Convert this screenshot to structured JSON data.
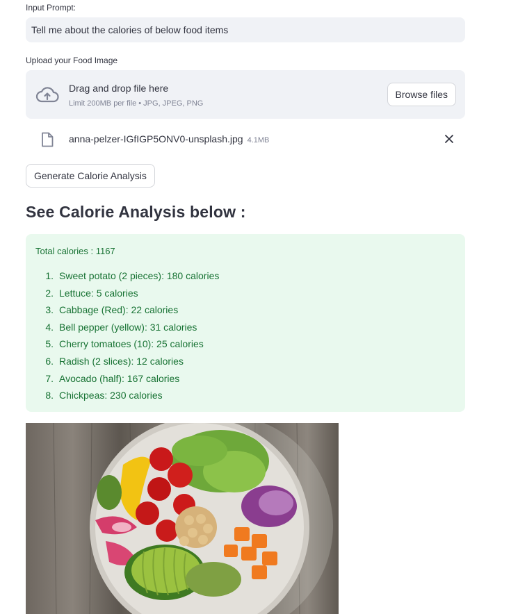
{
  "prompt": {
    "label": "Input Prompt:",
    "value": "Tell me about the calories of below food items"
  },
  "upload": {
    "label": "Upload your Food Image",
    "drag_title": "Drag and drop file here",
    "drag_sub": "Limit 200MB per file • JPG, JPEG, PNG",
    "browse_label": "Browse files",
    "file_name": "anna-pelzer-IGfIGP5ONV0-unsplash.jpg",
    "file_size": "4.1MB"
  },
  "generate_label": "Generate Calorie Analysis",
  "heading": "See Calorie Analysis below :",
  "analysis": {
    "total": "Total calories : 1167",
    "items": [
      {
        "num": "1.",
        "text": "Sweet potato (2 pieces): 180 calories"
      },
      {
        "num": "2.",
        "text": "Lettuce: 5 calories"
      },
      {
        "num": "3.",
        "text": "Cabbage (Red): 22 calories"
      },
      {
        "num": "4.",
        "text": "Bell pepper (yellow): 31 calories"
      },
      {
        "num": "5.",
        "text": "Cherry tomatoes (10): 25 calories"
      },
      {
        "num": "6.",
        "text": "Radish (2 slices): 12 calories"
      },
      {
        "num": "7.",
        "text": "Avocado (half): 167 calories"
      },
      {
        "num": "8.",
        "text": "Chickpeas: 230 calories"
      }
    ]
  },
  "colors": {
    "success_bg": "#e9f9ee",
    "success_text": "#177233",
    "input_bg": "#f0f2f6"
  },
  "icons": [
    "cloud-upload-icon",
    "file-icon",
    "close-icon"
  ]
}
